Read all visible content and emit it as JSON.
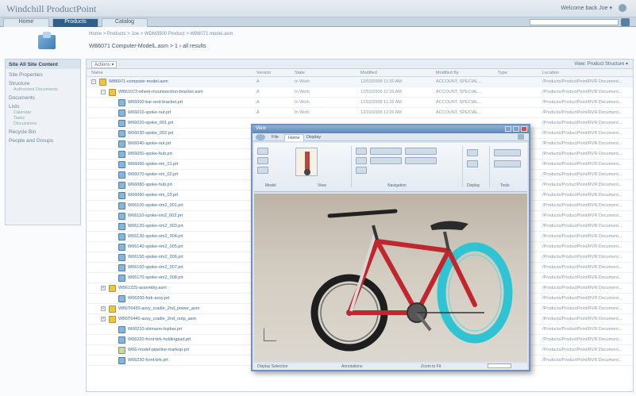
{
  "app": {
    "title": "Windchill ProductPoint",
    "user": "Welcome back Joe ▾"
  },
  "tabs": [
    {
      "label": "Home",
      "active": false
    },
    {
      "label": "Products",
      "active": true
    },
    {
      "label": "Catalog",
      "active": false
    }
  ],
  "breadcrumb": "Home > Products > Joe > WDM3500 Product > WB6071 model.asm",
  "page_title": "WB6071 Computer-ModelL.asm > 1 › all results",
  "sidebar": {
    "header": "Site All Site Content",
    "items": [
      {
        "label": "Site Properties"
      },
      {
        "label": "Structure",
        "sub": [
          "Authorized Documents"
        ]
      },
      {
        "label": "Documents"
      },
      {
        "label": "Lists",
        "sub": [
          "Calendar",
          "Tasks",
          "Discussions"
        ]
      },
      {
        "label": "Recycle Bin"
      },
      {
        "label": "People and Groups"
      }
    ]
  },
  "table": {
    "actions_label": "Actions ▾",
    "view_label": "View: Product Structure ▾",
    "columns": [
      "Name",
      "Version",
      "State",
      "Modified",
      "Modified By",
      "Type",
      "Location"
    ],
    "rows": [
      {
        "level": 0,
        "toggle": "−",
        "icon": "asm",
        "name": "WB6071-computer-model.asm",
        "version": "A",
        "state": "In Work",
        "modified": "12/02/2008 11:26 AM",
        "by": "ACCOUNT, SPECIAL...",
        "loc": "/Products/ProductPoint/RVR Document..."
      },
      {
        "level": 1,
        "toggle": "−",
        "icon": "asm",
        "name": "WB61072-wheel-mountsection-bracket.asm",
        "version": "A",
        "state": "In Work",
        "modified": "12/02/2008 11:26 AM",
        "by": "ACCOUNT, SPECIAL...",
        "loc": "/Products/ProductPoint/RVR Document..."
      },
      {
        "level": 2,
        "toggle": "",
        "icon": "prt",
        "name": "W66000-bar-end-bracket.prt",
        "version": "A",
        "state": "In Work",
        "modified": "12/02/2008 11:26 AM",
        "by": "ACCOUNT, SPECIAL...",
        "loc": "/Products/ProductPoint/RVR Document..."
      },
      {
        "level": 2,
        "toggle": "",
        "icon": "prt",
        "name": "W66010-spoke-nut.prt",
        "version": "A",
        "state": "In Work",
        "modified": "12/02/2008 11:26 AM",
        "by": "ACCOUNT, SPECIAL...",
        "loc": "/Products/ProductPoint/RVR Document..."
      },
      {
        "level": 2,
        "toggle": "",
        "icon": "prt",
        "name": "W66020-spoke_001.prt",
        "version": "",
        "state": "",
        "modified": "",
        "by": "",
        "loc": "/Products/ProductPoint/RVR Document..."
      },
      {
        "level": 2,
        "toggle": "",
        "icon": "prt",
        "name": "W66030-spoke_002.prt",
        "version": "",
        "state": "",
        "modified": "",
        "by": "",
        "loc": "/Products/ProductPoint/RVR Document..."
      },
      {
        "level": 2,
        "toggle": "",
        "icon": "prt",
        "name": "W66040-spoke-nut.prt",
        "version": "",
        "state": "",
        "modified": "",
        "by": "",
        "loc": "/Products/ProductPoint/RVR Document..."
      },
      {
        "level": 2,
        "toggle": "",
        "icon": "prt",
        "name": "W66050-spoke-hub.prt",
        "version": "",
        "state": "",
        "modified": "",
        "by": "",
        "loc": "/Products/ProductPoint/RVR Document..."
      },
      {
        "level": 2,
        "toggle": "",
        "icon": "prt",
        "name": "W66060-spoke-rim_01.prt",
        "version": "",
        "state": "",
        "modified": "",
        "by": "",
        "loc": "/Products/ProductPoint/RVR Document..."
      },
      {
        "level": 2,
        "toggle": "",
        "icon": "prt",
        "name": "W66070-spoke-rim_02.prt",
        "version": "",
        "state": "",
        "modified": "",
        "by": "",
        "loc": "/Products/ProductPoint/RVR Document..."
      },
      {
        "level": 2,
        "toggle": "",
        "icon": "prt",
        "name": "W66080-spoke-hub.prt",
        "version": "",
        "state": "",
        "modified": "",
        "by": "",
        "loc": "/Products/ProductPoint/RVR Document..."
      },
      {
        "level": 2,
        "toggle": "",
        "icon": "prt",
        "name": "W66090-spoke-rim_03.prt",
        "version": "",
        "state": "",
        "modified": "",
        "by": "",
        "loc": "/Products/ProductPoint/RVR Document..."
      },
      {
        "level": 2,
        "toggle": "",
        "icon": "prt",
        "name": "W66100-spoke-rim2_001.prt",
        "version": "",
        "state": "",
        "modified": "",
        "by": "",
        "loc": "/Products/ProductPoint/RVR Document..."
      },
      {
        "level": 2,
        "toggle": "",
        "icon": "prt",
        "name": "W66110-spoke-rim2_002.prt",
        "version": "",
        "state": "",
        "modified": "",
        "by": "",
        "loc": "/Products/ProductPoint/RVR Document..."
      },
      {
        "level": 2,
        "toggle": "",
        "icon": "prt",
        "name": "W66120-spoke-rim2_003.prt",
        "version": "",
        "state": "",
        "modified": "",
        "by": "",
        "loc": "/Products/ProductPoint/RVR Document..."
      },
      {
        "level": 2,
        "toggle": "",
        "icon": "prt",
        "name": "W66130-spoke-rim2_004.prt",
        "version": "",
        "state": "",
        "modified": "",
        "by": "",
        "loc": "/Products/ProductPoint/RVR Document..."
      },
      {
        "level": 2,
        "toggle": "",
        "icon": "prt",
        "name": "W66140-spoke-rim2_005.prt",
        "version": "",
        "state": "",
        "modified": "",
        "by": "",
        "loc": "/Products/ProductPoint/RVR Document..."
      },
      {
        "level": 2,
        "toggle": "",
        "icon": "prt",
        "name": "W66150-spoke-rim2_006.prt",
        "version": "",
        "state": "",
        "modified": "",
        "by": "",
        "loc": "/Products/ProductPoint/RVR Document..."
      },
      {
        "level": 2,
        "toggle": "",
        "icon": "prt",
        "name": "W66160-spoke-rim2_007.prt",
        "version": "",
        "state": "",
        "modified": "",
        "by": "",
        "loc": "/Products/ProductPoint/RVR Document..."
      },
      {
        "level": 2,
        "toggle": "",
        "icon": "prt",
        "name": "W66170-spoke-rim2_008.prt",
        "version": "",
        "state": "",
        "modified": "",
        "by": "",
        "loc": "/Products/ProductPoint/RVR Document..."
      },
      {
        "level": 1,
        "toggle": "+",
        "icon": "asm",
        "name": "WB61225-assembly.asm",
        "version": "",
        "state": "",
        "modified": "",
        "by": "",
        "loc": "/Products/ProductPoint/RVR Document..."
      },
      {
        "level": 2,
        "toggle": "",
        "icon": "prt",
        "name": "W66200-fork-assy.prt",
        "version": "",
        "state": "",
        "modified": "",
        "by": "",
        "loc": "/Products/ProductPoint/RVR Document..."
      },
      {
        "level": 1,
        "toggle": "+",
        "icon": "asm",
        "name": "WB6T6430-assy_cradle_2nd_power_asm",
        "version": "",
        "state": "",
        "modified": "",
        "by": "",
        "loc": "/Products/ProductPoint/RVR Document..."
      },
      {
        "level": 1,
        "toggle": "+",
        "icon": "asm",
        "name": "WB6T6440-assy_cradle_2nd_outp_asm",
        "version": "",
        "state": "",
        "modified": "",
        "by": "",
        "loc": "/Products/ProductPoint/RVR Document..."
      },
      {
        "level": 2,
        "toggle": "",
        "icon": "prt",
        "name": "W66210-shimano-topbar.prt",
        "version": "",
        "state": "",
        "modified": "",
        "by": "",
        "loc": "/Products/ProductPoint/RVR Document..."
      },
      {
        "level": 2,
        "toggle": "",
        "icon": "prt",
        "name": "W66220-front-brk-holdingpad.prt",
        "version": "",
        "state": "",
        "modified": "",
        "by": "",
        "loc": "/Products/ProductPoint/RVR Document..."
      },
      {
        "level": 2,
        "toggle": "",
        "icon": "drw",
        "name": "W66-model-pipeline-markup.prt",
        "version": "",
        "state": "",
        "modified": "",
        "by": "",
        "loc": "/Products/ProductPoint/RVR Document..."
      },
      {
        "level": 2,
        "toggle": "",
        "icon": "prt",
        "name": "W66230-front-brk.prt",
        "version": "",
        "state": "",
        "modified": "",
        "by": "",
        "loc": "/Products/ProductPoint/RVR Document..."
      }
    ]
  },
  "viewer": {
    "title": "View",
    "tabs": [
      "File",
      "Home",
      "Display"
    ],
    "groups": [
      "Model",
      "View",
      "Navigation",
      "Display",
      "Tools"
    ],
    "status_left": "Display Selection",
    "status_mid": "Annotations",
    "status_right": "Zoom to Fit",
    "highlight_color": "#2ec4d3",
    "frame_color": "#c0262e"
  }
}
